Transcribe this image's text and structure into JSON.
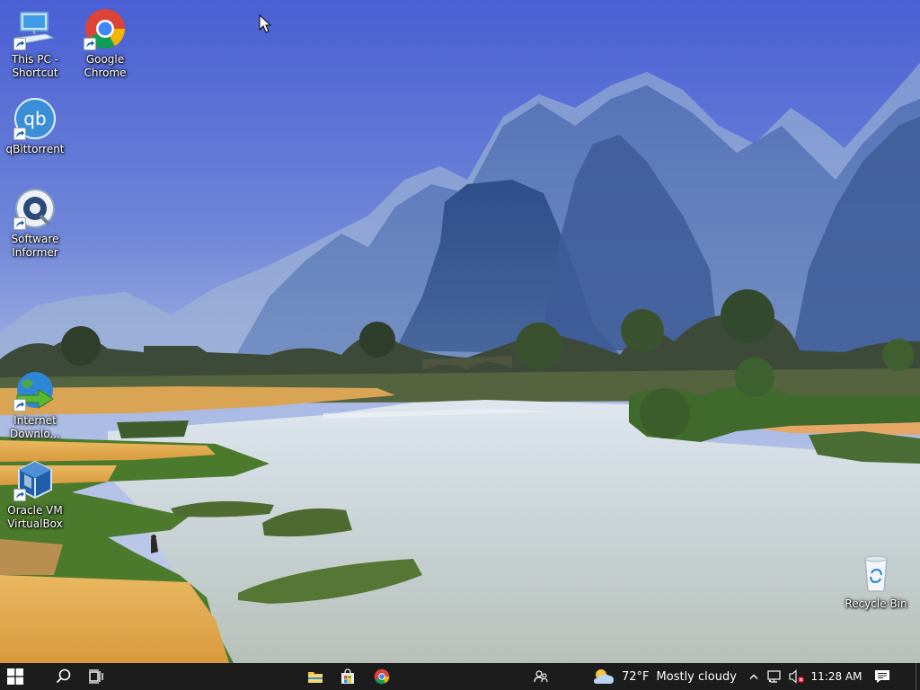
{
  "desktop": {
    "icons": [
      {
        "id": "this-pc",
        "label": "This PC -\nShortcut",
        "icon": "computer-icon",
        "shortcut": true
      },
      {
        "id": "google-chrome",
        "label": "Google\nChrome",
        "icon": "chrome-icon",
        "shortcut": true
      },
      {
        "id": "qbittorrent",
        "label": "qBittorrent",
        "icon": "qbittorrent-icon",
        "shortcut": true
      },
      {
        "id": "software-informer",
        "label": "Software\nInformer",
        "icon": "software-informer-icon",
        "shortcut": true
      },
      {
        "id": "internet-download-manager",
        "label": "Internet\nDownlo...",
        "icon": "idm-globe-icon",
        "shortcut": true
      },
      {
        "id": "oracle-vm-virtualbox",
        "label": "Oracle VM\nVirtualBox",
        "icon": "virtualbox-icon",
        "shortcut": true
      },
      {
        "id": "recycle-bin",
        "label": "Recycle Bin",
        "icon": "recycle-bin-icon",
        "shortcut": false
      }
    ]
  },
  "taskbar": {
    "start_icon": "windows-logo-icon",
    "search_icon": "search-icon",
    "task_view_icon": "task-view-icon",
    "pinned": [
      {
        "id": "file-explorer",
        "icon": "folder-icon"
      },
      {
        "id": "microsoft-store",
        "icon": "store-bag-icon"
      },
      {
        "id": "chrome",
        "icon": "chrome-icon"
      }
    ],
    "people_icon": "people-icon",
    "weather": {
      "icon": "partly-cloudy-icon",
      "temperature": "72°F",
      "condition": "Mostly cloudy"
    },
    "tray": {
      "chevron_icon": "chevron-up-icon",
      "network_icon": "network-disconnected-icon",
      "volume_icon": "volume-muted-icon",
      "time": "11:28 AM",
      "notifications_icon": "action-center-icon"
    }
  },
  "colors": {
    "sky_top": "#4a63d6",
    "sky_bottom": "#b9c6e8",
    "taskbar": "#1c1c1c",
    "field_gold": "#e7b25a",
    "grass": "#4e7a2e"
  }
}
